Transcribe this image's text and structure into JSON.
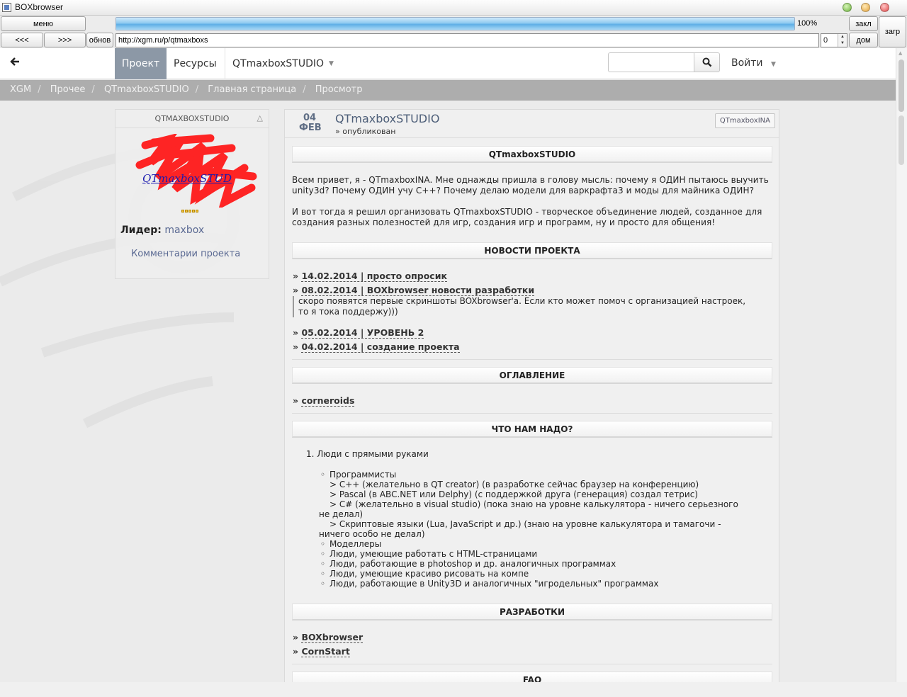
{
  "window": {
    "title": "BOXbrowser"
  },
  "toolbar": {
    "menu": "меню",
    "back": "<<<",
    "forward": ">>>",
    "refresh": "обнов",
    "close_tab": "закл",
    "home": "дом",
    "download": "загр",
    "progress_percent": 100,
    "progress_text": "100%",
    "url": "http://xgm.ru/p/qtmaxboxs",
    "zoom_value": "0"
  },
  "navbar": {
    "back_icon": "arrow-left-icon",
    "items": [
      {
        "label": "Проект",
        "active": true
      },
      {
        "label": "Ресурсы"
      },
      {
        "label": "QTmaxboxSTUDIO",
        "dropdown": true
      }
    ],
    "search_placeholder": "",
    "search_icon": "search-icon",
    "login": "Войти"
  },
  "breadcrumbs": [
    "XGM",
    "Прочее",
    "QTmaxboxSTUDIO",
    "Главная страница",
    "Просмотр"
  ],
  "sidebar": {
    "title": "QTMAXBOXSTUDIO",
    "collapse_icon": "triangle-up-icon",
    "logo_text": "QTmaxboxSTUD",
    "rating_stars": 5,
    "leader_label": "Лидер:",
    "leader_name": "maxbox",
    "comments_link": "Комментарии проекта"
  },
  "post": {
    "day": "04",
    "month": "ФЕВ",
    "title": "QTmaxboxSTUDIO",
    "status": "» опубликован",
    "author": "QTmaxboxINA",
    "intro_heading": "QTmaxboxSTUDIO",
    "intro": "Всем привет, я - QTmaxboxINA. Мне однажды пришла в голову мысль: почему я ОДИН пытаюсь выучить unity3d? Почему ОДИН учу C++? Почему делаю модели для варкрафта3 и моды для майника ОДИН?",
    "intro2": "И вот тогда я решил организовать QTmaxboxSTUDIO - творческое объединение людей, созданное для создания разных полезностей для игр, создания игр и программ, ну и просто для общения!",
    "news_heading": "НОВОСТИ ПРОЕКТА",
    "news": [
      {
        "prefix": "»",
        "title": "14.02.2014 | просто опросик"
      },
      {
        "prefix": "»",
        "title": "08.02.2014 | BOXbrowser новости разработки"
      },
      {
        "prefix": "»",
        "title": "05.02.2014 | УРОВЕНЬ 2"
      },
      {
        "prefix": "»",
        "title": "04.02.2014 | создание проекта"
      }
    ],
    "news_quote": "скоро появятся первые скриншоты BOXbrowser'a. Если кто может помоч с организацией настроек, то я тока поддержу)))",
    "toc_heading": "ОГЛАВЛЕНИЕ",
    "toc": [
      {
        "prefix": "»",
        "title": "corneroids"
      }
    ],
    "needs_heading": "ЧТО НАМ НАДО?",
    "needs_main": "1.  Люди с прямыми руками",
    "needs": {
      "programmers": "Программисты",
      "cpp": "> C++ (желательно в QT creator) (в разработке сейчас браузер на конференцию)",
      "pascal": "> Pascal (в ABC.NET или Delphy) (с поддержкой друга (генерация) создал тетрис)",
      "csharp1": "> C# (желательно в visual studio) (пока знаю на уровне калькулятора - ничего серьезного",
      "csharp2": "не делал)",
      "script1": "> Скриптовые языки (Lua, JavaScript и др.) (знаю на уровне калькулятора и тамагочи -",
      "script2": "ничего особо не делал)",
      "modelers": "Моделлеры",
      "html": "Люди, умеющие работать с HTML-страницами",
      "photoshop": "Люди, работающие в photoshop и др. аналогичных программах",
      "draw": "Люди, умеющие красиво рисовать на компе",
      "unity": "Люди, работающие в Unity3D и аналогичных \"игродельных\" программах"
    },
    "dev_heading": "РАЗРАБОТКИ",
    "dev": [
      {
        "prefix": "»",
        "title": "BOXbrowser"
      },
      {
        "prefix": "»",
        "title": "CornStart"
      }
    ],
    "faq_heading": "FAQ"
  },
  "colors": {
    "nav_active": "#8c98a6",
    "link": "#5b6a93",
    "breadcrumb_bg": "#adadad",
    "progress": "#5eaee6"
  }
}
